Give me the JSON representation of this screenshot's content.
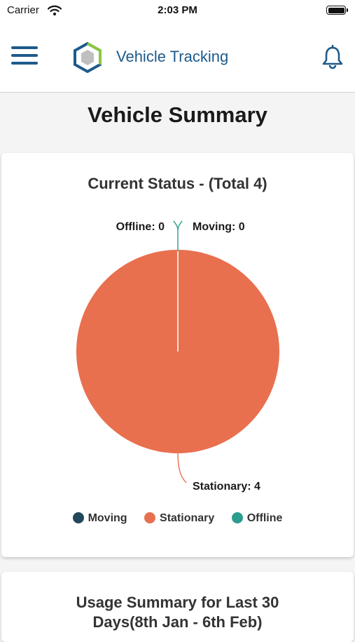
{
  "status_bar": {
    "carrier": "Carrier",
    "time": "2:03 PM"
  },
  "app_bar": {
    "title": "Vehicle Tracking"
  },
  "page": {
    "title": "Vehicle Summary"
  },
  "status_card": {
    "title": "Current Status - (Total 4)",
    "chart_data": {
      "type": "pie",
      "title": "Current Status - (Total 4)",
      "categories": [
        "Moving",
        "Stationary",
        "Offline"
      ],
      "values": [
        0,
        4,
        0
      ],
      "colors": [
        "#24475a",
        "#e8704f",
        "#2a9d8f"
      ],
      "data_labels": [
        "Moving: 0",
        "Stationary: 4",
        "Offline: 0"
      ],
      "legend": "bottom"
    },
    "legend": [
      {
        "label": "Moving",
        "color": "#24475a"
      },
      {
        "label": "Stationary",
        "color": "#e8704f"
      },
      {
        "label": "Offline",
        "color": "#2a9d8f"
      }
    ]
  },
  "usage_card": {
    "title_line1": "Usage Summary for Last 30",
    "title_line2": "Days(8th Jan - 6th Feb)"
  },
  "colors": {
    "brand_blue": "#1e5a8a",
    "logo_green": "#8cc63f"
  }
}
